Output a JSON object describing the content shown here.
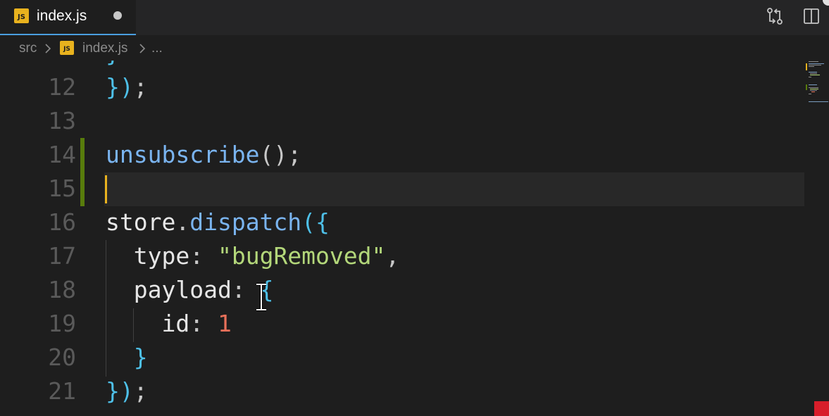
{
  "tab": {
    "file_icon_text": "JS",
    "filename": "index.js",
    "dirty_indicator": "unsaved-dot",
    "icons": {
      "compare": "git-compare-icon",
      "split": "split-editor-icon"
    }
  },
  "breadcrumb": {
    "folder": "src",
    "file_icon_text": "JS",
    "file": "index.js",
    "more": "..."
  },
  "editor": {
    "lines": [
      {
        "number": "12",
        "tokens": [
          {
            "t": "})",
            "c": "t-brace"
          },
          {
            "t": ";",
            "c": "t-punct"
          }
        ]
      },
      {
        "number": "13",
        "tokens": []
      },
      {
        "number": "14",
        "tokens": [
          {
            "t": "unsubscribe",
            "c": "t-func"
          },
          {
            "t": "()",
            "c": "t-punct"
          },
          {
            "t": ";",
            "c": "t-punct"
          }
        ]
      },
      {
        "number": "15",
        "tokens": []
      },
      {
        "number": "16",
        "tokens": [
          {
            "t": "store",
            "c": "t-ident"
          },
          {
            "t": ".",
            "c": "t-punct"
          },
          {
            "t": "dispatch",
            "c": "t-func"
          },
          {
            "t": "({",
            "c": "t-brace"
          }
        ]
      },
      {
        "number": "17",
        "tokens": [
          {
            "t": "  type",
            "c": "t-key"
          },
          {
            "t": ": ",
            "c": "t-punct"
          },
          {
            "t": "\"bugRemoved\"",
            "c": "t-str"
          },
          {
            "t": ",",
            "c": "t-punct"
          }
        ]
      },
      {
        "number": "18",
        "tokens": [
          {
            "t": "  payload",
            "c": "t-key"
          },
          {
            "t": ": ",
            "c": "t-punct"
          },
          {
            "t": "{",
            "c": "t-brace"
          }
        ]
      },
      {
        "number": "19",
        "tokens": [
          {
            "t": "    id",
            "c": "t-key"
          },
          {
            "t": ": ",
            "c": "t-punct"
          },
          {
            "t": "1",
            "c": "t-num"
          }
        ]
      },
      {
        "number": "20",
        "tokens": [
          {
            "t": "  }",
            "c": "t-brace"
          }
        ]
      },
      {
        "number": "21",
        "tokens": [
          {
            "t": "})",
            "c": "t-brace"
          },
          {
            "t": ";",
            "c": "t-punct"
          }
        ]
      }
    ],
    "current_line": "15",
    "modified_lines": [
      "14",
      "15"
    ]
  },
  "colors": {
    "background": "#1e1e1e",
    "tabbar": "#252526",
    "active_tab_border": "#4a9ee0",
    "js_badge": "#e8b21e",
    "cursor": "#e8b21e",
    "gutter_modified": "#587c0c",
    "brace": "#4ec0e8",
    "function": "#7ab4f0",
    "string": "#b3d77a",
    "number": "#e8705a"
  }
}
